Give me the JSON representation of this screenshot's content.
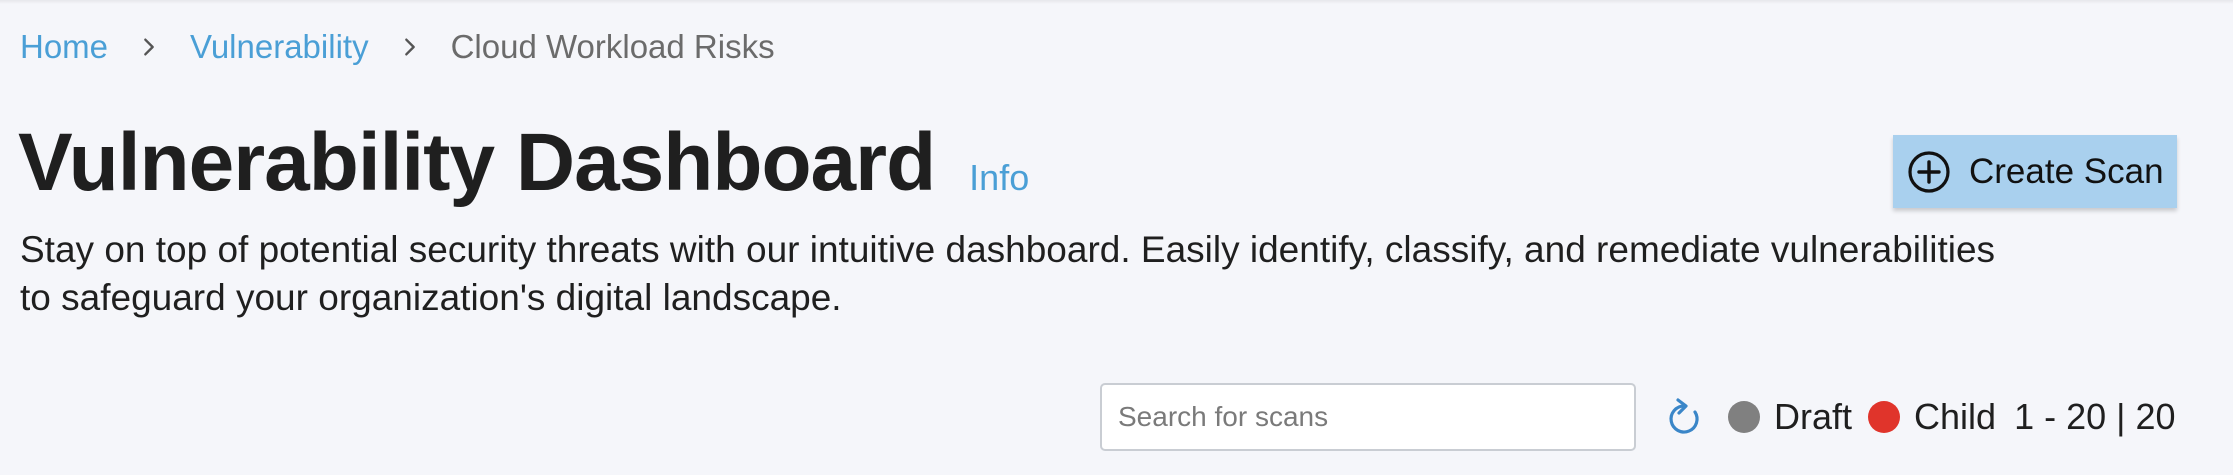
{
  "breadcrumb": {
    "items": [
      {
        "label": "Home",
        "link": true
      },
      {
        "label": "Vulnerability",
        "link": true
      },
      {
        "label": "Cloud Workload Risks",
        "link": false
      }
    ]
  },
  "header": {
    "title": "Vulnerability Dashboard",
    "info_label": "Info",
    "description": "Stay on top of potential security threats with our intuitive dashboard. Easily identify, classify, and remediate vulnerabilities to safeguard your organization's digital landscape."
  },
  "actions": {
    "create_scan_label": "Create Scan",
    "create_scan_icon": "plus-circle-icon"
  },
  "toolbar": {
    "search_placeholder": "Search for scans",
    "search_value": "",
    "refresh_icon": "refresh-icon",
    "legend": [
      {
        "label": "Draft",
        "color": "#808080"
      },
      {
        "label": "Child",
        "color": "#e0342b"
      }
    ],
    "pagination": "1 - 20 | 20"
  },
  "colors": {
    "accent": "#4a9fd6",
    "background": "#f5f6fa",
    "button_bg": "#a9d0ee"
  }
}
